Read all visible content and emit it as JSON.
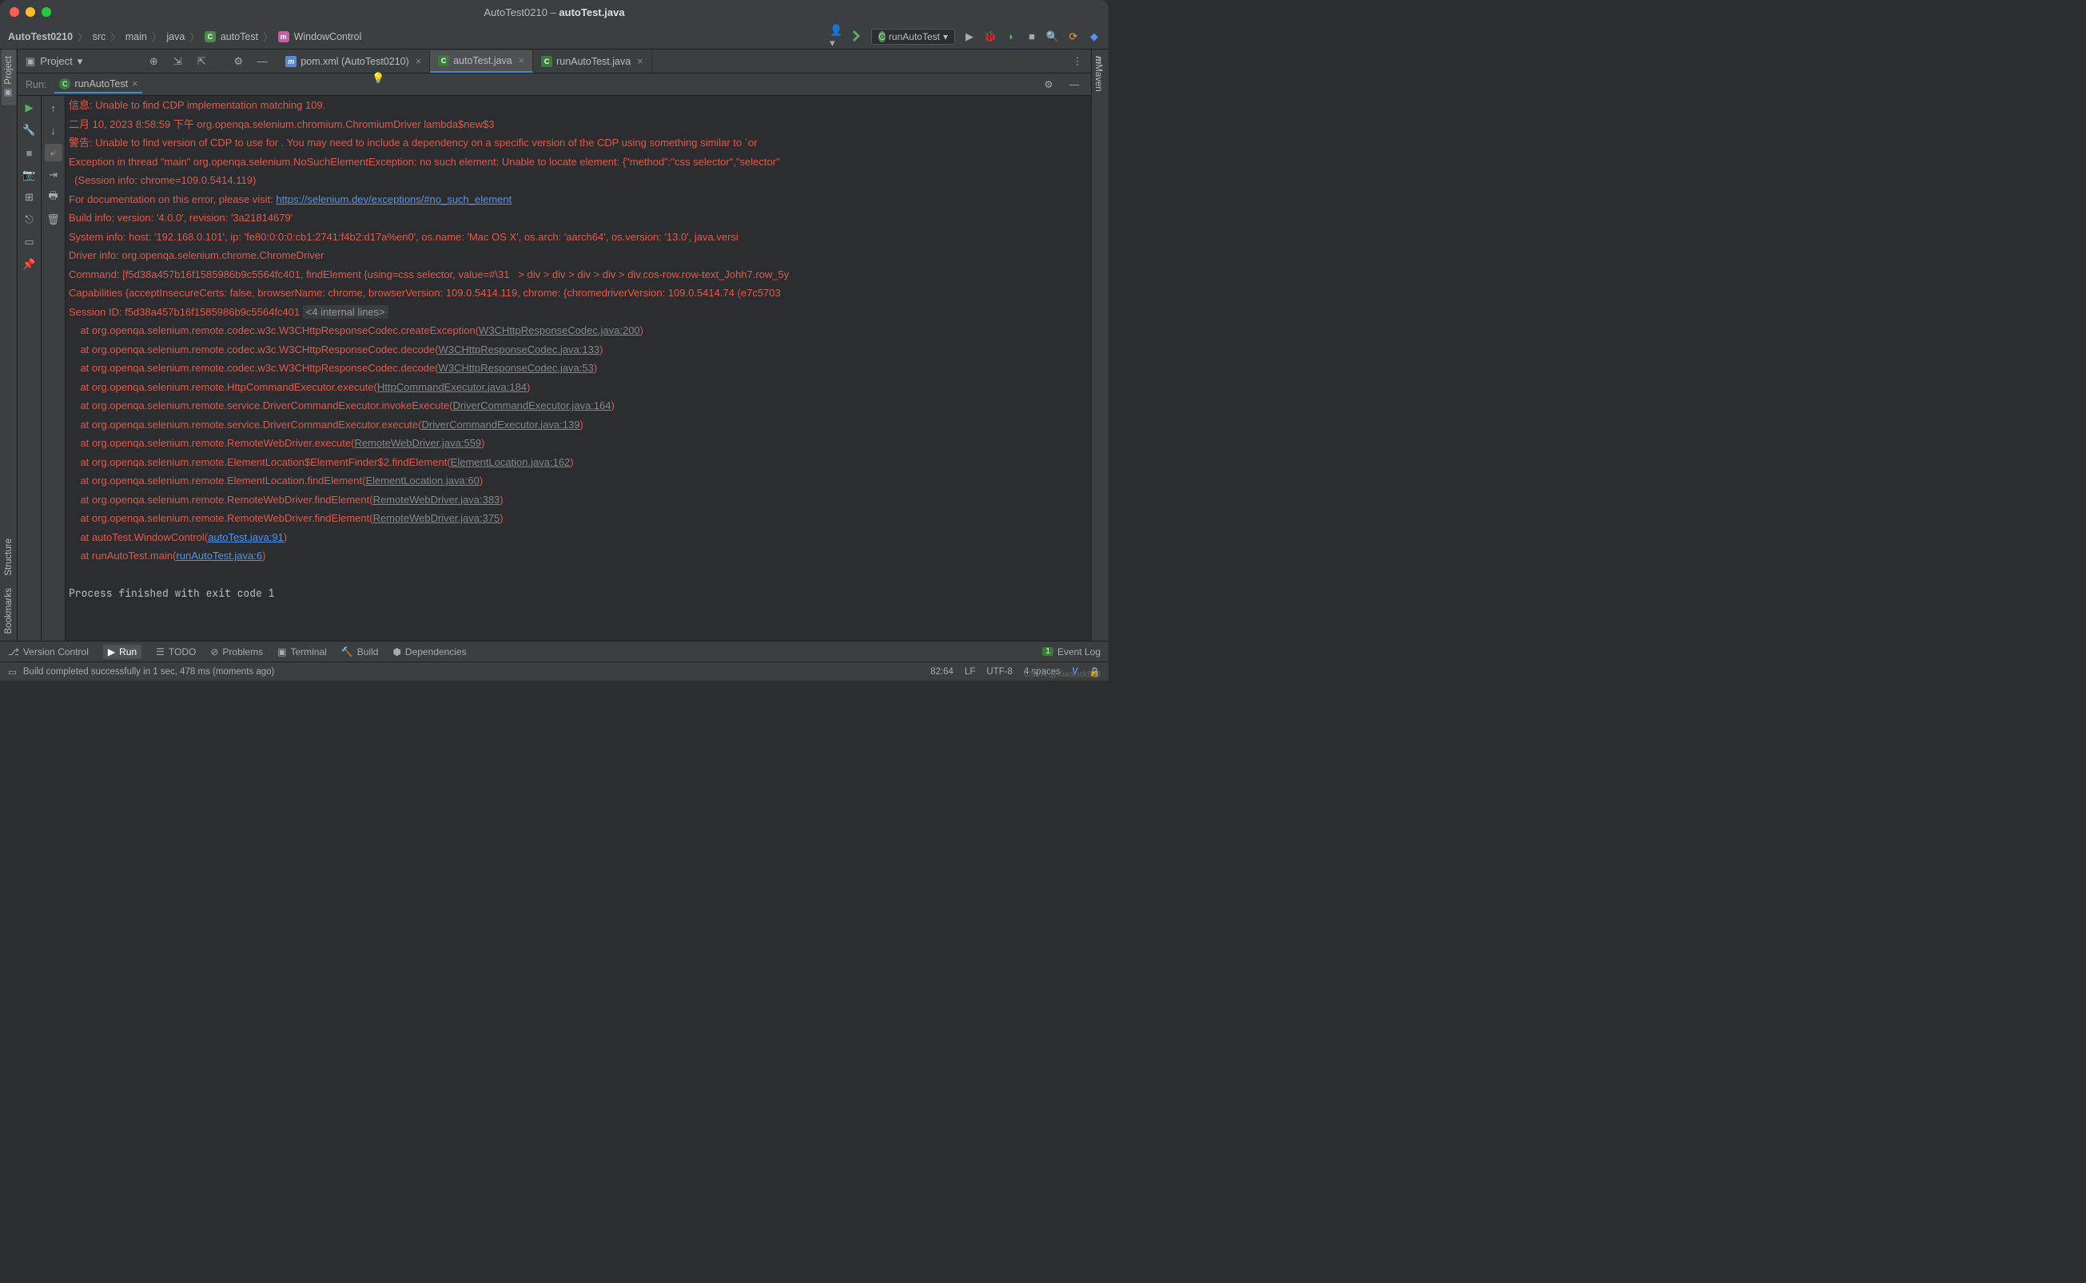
{
  "title": {
    "project": "AutoTest0210",
    "file": "autoTest.java"
  },
  "breadcrumb": [
    "AutoTest0210",
    "src",
    "main",
    "java",
    "autoTest",
    "WindowControl"
  ],
  "runConfig": "runAutoTest",
  "projectLabel": "Project",
  "tabs": [
    {
      "label": "pom.xml (AutoTest0210)",
      "icon": "m"
    },
    {
      "label": "autoTest.java",
      "icon": "c",
      "active": true
    },
    {
      "label": "runAutoTest.java",
      "icon": "c"
    }
  ],
  "runTab": {
    "label": "Run:",
    "config": "runAutoTest"
  },
  "console": {
    "l1": "信息: Unable to find CDP implementation matching 109.",
    "l2": "二月 10, 2023 8:58:59 下午 org.openqa.selenium.chromium.ChromiumDriver lambda$new$3",
    "l3": "警告: Unable to find version of CDP to use for . You may need to include a dependency on a specific version of the CDP using something similar to `or",
    "l4": "Exception in thread \"main\" org.openqa.selenium.NoSuchElementException: no such element: Unable to locate element: {\"method\":\"css selector\",\"selector\"",
    "l5": "  (Session info: chrome=109.0.5414.119)",
    "l6a": "For documentation on this error, please visit: ",
    "l6b": "https://selenium.dev/exceptions/#no_such_element",
    "l7": "Build info: version: '4.0.0', revision: '3a21814679'",
    "l8": "System info: host: '192.168.0.101', ip: 'fe80:0:0:0:cb1:2741:f4b2:d17a%en0', os.name: 'Mac OS X', os.arch: 'aarch64', os.version: '13.0', java.versi",
    "l9": "Driver info: org.openqa.selenium.chrome.ChromeDriver",
    "l10": "Command: [f5d38a457b16f1585986b9c5564fc401, findElement {using=css selector, value=#\\31   > div > div > div > div > div.cos-row.row-text_Johh7.row_5y",
    "l11": "Capabilities {acceptInsecureCerts: false, browserName: chrome, browserVersion: 109.0.5414.119, chrome: {chromedriverVersion: 109.0.5414.74 (e7c5703",
    "l12a": "Session ID: f5d38a457b16f1585986b9c5564fc401 ",
    "l12b": "<4 internal lines>",
    "traces": [
      {
        "pre": "    at org.openqa.selenium.remote.codec.w3c.W3CHttpResponseCodec.createException(",
        "link": "W3CHttpResponseCodec.java:200",
        "suf": ")"
      },
      {
        "pre": "    at org.openqa.selenium.remote.codec.w3c.W3CHttpResponseCodec.decode(",
        "link": "W3CHttpResponseCodec.java:133",
        "suf": ")"
      },
      {
        "pre": "    at org.openqa.selenium.remote.codec.w3c.W3CHttpResponseCodec.decode(",
        "link": "W3CHttpResponseCodec.java:53",
        "suf": ")"
      },
      {
        "pre": "    at org.openqa.selenium.remote.HttpCommandExecutor.execute(",
        "link": "HttpCommandExecutor.java:184",
        "suf": ")"
      },
      {
        "pre": "    at org.openqa.selenium.remote.service.DriverCommandExecutor.invokeExecute(",
        "link": "DriverCommandExecutor.java:164",
        "suf": ")"
      },
      {
        "pre": "    at org.openqa.selenium.remote.service.DriverCommandExecutor.execute(",
        "link": "DriverCommandExecutor.java:139",
        "suf": ")"
      },
      {
        "pre": "    at org.openqa.selenium.remote.RemoteWebDriver.execute(",
        "link": "RemoteWebDriver.java:559",
        "suf": ")"
      },
      {
        "pre": "    at org.openqa.selenium.remote.ElementLocation$ElementFinder$2.findElement(",
        "link": "ElementLocation.java:162",
        "suf": ")"
      },
      {
        "pre": "    at org.openqa.selenium.remote.ElementLocation.findElement(",
        "link": "ElementLocation.java:60",
        "suf": ")"
      },
      {
        "pre": "    at org.openqa.selenium.remote.RemoteWebDriver.findElement(",
        "link": "RemoteWebDriver.java:383",
        "suf": ")"
      },
      {
        "pre": "    at org.openqa.selenium.remote.RemoteWebDriver.findElement(",
        "link": "RemoteWebDriver.java:375",
        "suf": ")"
      },
      {
        "pre": "    at autoTest.WindowControl(",
        "link": "autoTest.java:91",
        "suf": ")",
        "blue": true
      },
      {
        "pre": "    at runAutoTest.main(",
        "link": "runAutoTest.java:6",
        "suf": ")",
        "blue": true
      }
    ],
    "exit": "Process finished with exit code 1"
  },
  "bottomTabs": [
    "Version Control",
    "Run",
    "TODO",
    "Problems",
    "Terminal",
    "Build",
    "Dependencies"
  ],
  "eventLog": {
    "count": "1",
    "label": "Event Log"
  },
  "status": {
    "msg": "Build completed successfully in 1 sec, 478 ms (moments ago)",
    "pos": "82:64",
    "lf": "LF",
    "enc": "UTF-8",
    "indent": "4 spaces"
  },
  "sideTabs": {
    "project": "Project",
    "structure": "Structure",
    "bookmarks": "Bookmarks",
    "maven": "Maven"
  },
  "watermark": "CSDN @Xiaolock830"
}
